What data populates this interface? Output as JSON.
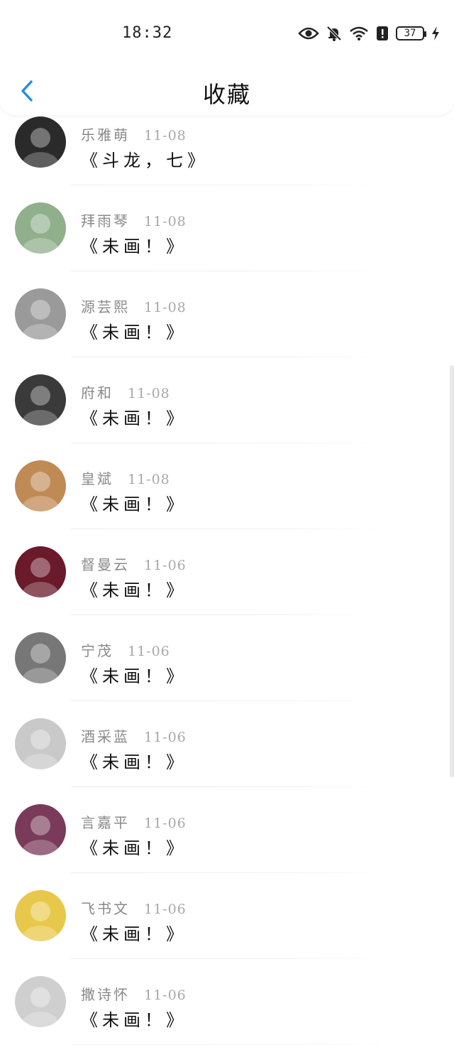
{
  "status_bar": {
    "time": "18:32",
    "battery": "37"
  },
  "header": {
    "title": "收藏"
  },
  "items": [
    {
      "author": "乐雅萌",
      "date": "11-08",
      "title": "《斗龙，七》",
      "avatar": "#2a2a2a"
    },
    {
      "author": "拜雨琴",
      "date": "11-08",
      "title": "《未画！》",
      "avatar": "#8fb08a"
    },
    {
      "author": "源芸熙",
      "date": "11-08",
      "title": "《未画！》",
      "avatar": "#9a9a9a"
    },
    {
      "author": "府和",
      "date": "11-08",
      "title": "《未画！》",
      "avatar": "#3a3a3a"
    },
    {
      "author": "皇斌",
      "date": "11-08",
      "title": "《未画！》",
      "avatar": "#c08a55"
    },
    {
      "author": "督曼云",
      "date": "11-06",
      "title": "《未画！》",
      "avatar": "#6a1a2a"
    },
    {
      "author": "宁茂",
      "date": "11-06",
      "title": "《未画！》",
      "avatar": "#777777"
    },
    {
      "author": "酒采蓝",
      "date": "11-06",
      "title": "《未画！》",
      "avatar": "#c9c9c9"
    },
    {
      "author": "言嘉平",
      "date": "11-06",
      "title": "《未画！》",
      "avatar": "#7a3a5a"
    },
    {
      "author": "飞书文",
      "date": "11-06",
      "title": "《未画！》",
      "avatar": "#e8c84a"
    },
    {
      "author": "撒诗怀",
      "date": "11-06",
      "title": "《未画！》",
      "avatar": "#cfcfcf"
    }
  ]
}
